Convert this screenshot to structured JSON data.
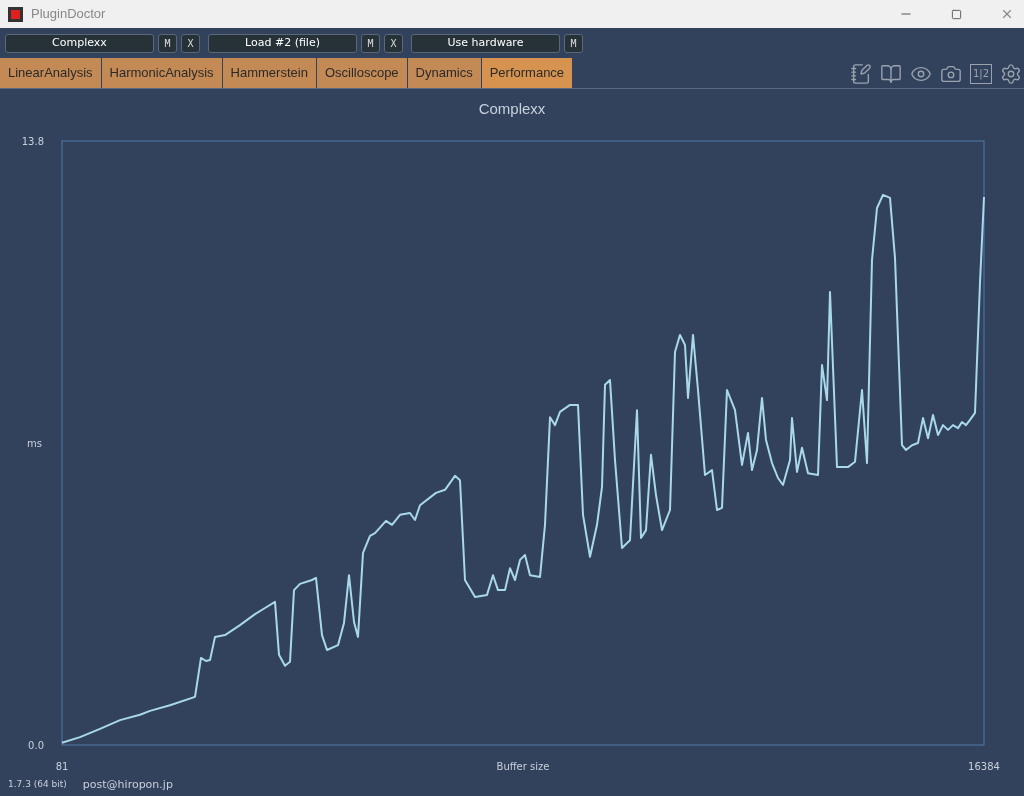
{
  "window": {
    "title": "PluginDoctor"
  },
  "slots": [
    {
      "label": "Complexx",
      "buttons": [
        "M",
        "X"
      ]
    },
    {
      "label": "Load #2 (file)",
      "buttons": [
        "M",
        "X"
      ]
    },
    {
      "label": "Use hardware",
      "buttons": [
        "M"
      ]
    }
  ],
  "tabs": [
    {
      "label": "LinearAnalysis",
      "selected": false
    },
    {
      "label": "HarmonicAnalysis",
      "selected": false
    },
    {
      "label": "Hammerstein",
      "selected": false
    },
    {
      "label": "Oscilloscope",
      "selected": false
    },
    {
      "label": "Dynamics",
      "selected": false
    },
    {
      "label": "Performance",
      "selected": true
    }
  ],
  "compare_button": "1|2",
  "chart": {
    "chart_data": {
      "type": "line",
      "title": "Complexx",
      "xlabel": "Buffer size",
      "ylabel": "ms",
      "xlim": [
        81,
        16384
      ],
      "ylim": [
        0,
        13.8
      ],
      "xticks": [
        81,
        16384
      ],
      "yticks": [
        {
          "value": 0,
          "label": "0.0"
        },
        {
          "value": 13.8,
          "label": "13.8"
        }
      ],
      "x": [
        81,
        399,
        753,
        1107,
        1460,
        1637,
        1991,
        2433,
        2539,
        2627,
        2698,
        2786,
        2963,
        3228,
        3494,
        3670,
        3847,
        3918,
        4024,
        4112,
        4183,
        4289,
        4502,
        4572,
        4678,
        4767,
        4961,
        5067,
        5156,
        5244,
        5315,
        5403,
        5527,
        5615,
        5810,
        5916,
        6058,
        6234,
        6323,
        6411,
        6694,
        6853,
        7030,
        7118,
        7207,
        7384,
        7596,
        7702,
        7790,
        7914,
        8003,
        8091,
        8179,
        8268,
        8356,
        8533,
        8621,
        8710,
        8798,
        8887,
        9063,
        9205,
        9293,
        9417,
        9541,
        9629,
        9682,
        9771,
        9859,
        9983,
        10124,
        10248,
        10319,
        10407,
        10496,
        10584,
        10690,
        10832,
        10920,
        11009,
        11097,
        11150,
        11238,
        11327,
        11451,
        11574,
        11663,
        11751,
        11840,
        11981,
        12105,
        12211,
        12282,
        12370,
        12458,
        12529,
        12635,
        12741,
        12830,
        12953,
        12989,
        13077,
        13166,
        13272,
        13449,
        13519,
        13608,
        13661,
        13785,
        13979,
        14103,
        14227,
        14315,
        14403,
        14492,
        14598,
        14722,
        14810,
        14934,
        15005,
        15111,
        15217,
        15305,
        15394,
        15482,
        15571,
        15659,
        15747,
        15836,
        15924,
        15995,
        16066,
        16136,
        16225,
        16313,
        16384
      ],
      "series": [
        {
          "color": "#a8d8ea",
          "values": [
            0.05,
            0.18,
            0.37,
            0.57,
            0.69,
            0.78,
            0.91,
            1.1,
            1.99,
            1.92,
            1.94,
            2.47,
            2.51,
            2.74,
            2.99,
            3.13,
            3.27,
            2.06,
            1.81,
            1.9,
            3.54,
            3.68,
            3.77,
            3.82,
            2.51,
            2.17,
            2.28,
            2.79,
            3.88,
            2.81,
            2.47,
            4.39,
            4.78,
            4.84,
            5.12,
            5.03,
            5.26,
            5.3,
            5.14,
            5.48,
            5.76,
            5.83,
            6.15,
            6.05,
            3.77,
            3.38,
            3.43,
            3.88,
            3.54,
            3.54,
            4.04,
            3.77,
            4.23,
            4.34,
            3.88,
            3.84,
            5.03,
            7.49,
            7.31,
            7.61,
            7.77,
            7.77,
            5.26,
            4.3,
            5.03,
            5.89,
            8.23,
            8.34,
            6.51,
            4.5,
            4.68,
            7.65,
            4.73,
            4.91,
            6.63,
            5.71,
            4.91,
            5.37,
            8.98,
            9.37,
            9.14,
            7.93,
            9.37,
            8.11,
            6.17,
            6.28,
            5.37,
            5.42,
            8.11,
            7.65,
            6.4,
            7.13,
            6.28,
            6.74,
            7.93,
            6.97,
            6.44,
            6.1,
            5.94,
            6.51,
            7.47,
            6.24,
            6.79,
            6.21,
            6.17,
            8.68,
            7.88,
            10.35,
            6.35,
            6.35,
            6.47,
            8.11,
            6.44,
            11.08,
            12.27,
            12.57,
            12.5,
            11.13,
            6.85,
            6.74,
            6.85,
            6.9,
            7.47,
            7.01,
            7.54,
            7.08,
            7.31,
            7.2,
            7.31,
            7.24,
            7.38,
            7.31,
            7.43,
            7.59,
            10.56,
            12.52
          ]
        }
      ]
    }
  },
  "footer": {
    "version": "1.7.3 (64 bit)",
    "email": "post@hiropon.jp"
  }
}
